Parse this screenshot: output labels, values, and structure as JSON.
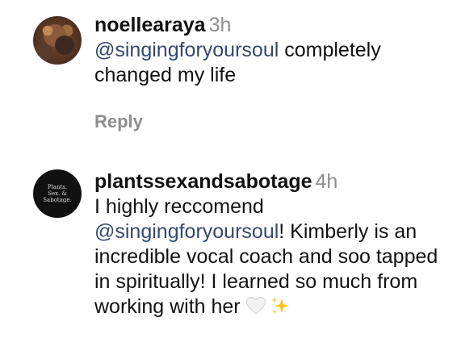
{
  "comments": [
    {
      "username": "noellearaya",
      "time": "3h",
      "mention": "@singingforyoursoul",
      "text_after_mention": " completely changed my life",
      "reply_label": "Reply"
    },
    {
      "username": "plantssexandsabotage",
      "time": "4h",
      "avatar_text": "Plants. Sex. & Sabotage.",
      "text_before_mention": "I highly reccomend ",
      "mention": "@singingforyoursoul",
      "text_after_mention": "! Kimberly is an incredible vocal coach and soo tapped in spiritually! I learned so much from working with her",
      "emojis": [
        "white-heart-icon",
        "sparkles-icon"
      ]
    }
  ],
  "colors": {
    "mention": "#34496e",
    "muted": "#8e8e8e",
    "text": "#111111",
    "sparkle": "#f5c518"
  }
}
